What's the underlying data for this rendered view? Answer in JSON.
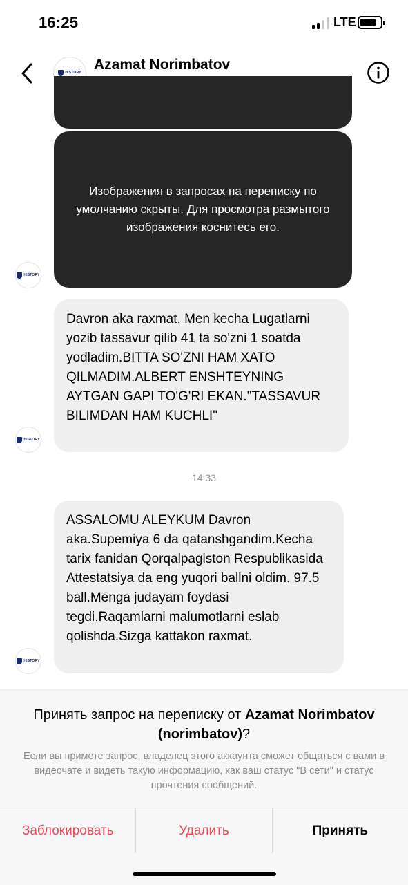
{
  "status_bar": {
    "time": "16:25",
    "network": "LTE",
    "signal_bars_active": 2,
    "signal_bars_total": 4,
    "battery_level": 0.8
  },
  "header": {
    "name": "Azamat Norimbatov",
    "username": "norimbatov",
    "back_icon": "chevron-left-icon",
    "info_icon": "info-circle-icon",
    "avatar_logo_text": "HISTORY"
  },
  "messages": {
    "hidden_image_notice": "Изображения в запросах на переписку по умолчанию скрыты. Для просмотра размытого изображения коснитесь его.",
    "message1": "Davron aka raxmat. Men kecha Lugatlarni yozib tassavur qilib 41 ta so'zni 1 soatda yodladim.BITTA SO'ZNI HAM XATO QILMADIM.ALBERT ENSHTEYNING AYTGAN GAPI TO'G'RI EKAN.\"TASSAVUR BILIMDAN HAM KUCHLI\"",
    "timestamp": "14:33",
    "message2": "ASSALOMU ALEYKUM Davron aka.Supemiya 6 da qatanshgandim.Kecha tarix fanidan Qorqalpagiston Respublikasida Attestatsiya da eng yuqori ballni oldim. 97.5 ball.Menga judayam foydasi tegdi.Raqamlarni malumotlarni eslab qolishda.Sizga kattakon raxmat."
  },
  "request": {
    "title_prefix": "Принять запрос на переписку от",
    "title_name": "Azamat Norimbatov (norimbatov)",
    "title_suffix": "?",
    "description": "Если вы примете запрос, владелец этого аккаунта сможет общаться с вами в видеочате и видеть такую информацию, как ваш статус \"В сети\" и статус прочтения сообщений."
  },
  "actions": {
    "block_label": "Заблокировать",
    "delete_label": "Удалить",
    "accept_label": "Принять"
  },
  "colors": {
    "destructive": "#ed4956",
    "secondary_text": "#8e8e8e",
    "dark_bubble": "#262626",
    "light_bubble": "#efefef"
  }
}
